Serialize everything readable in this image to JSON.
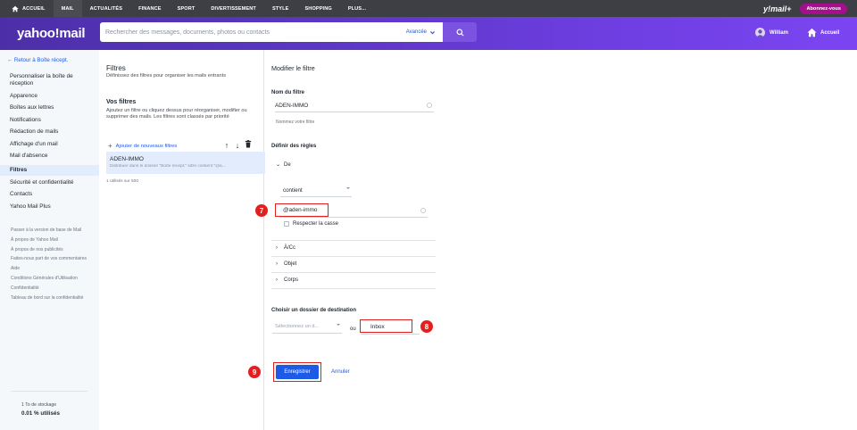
{
  "topnav": {
    "items": [
      "ACCUEIL",
      "MAIL",
      "ACTUALITÉS",
      "FINANCE",
      "SPORT",
      "DIVERTISSEMENT",
      "STYLE",
      "SHOPPING",
      "PLUS..."
    ],
    "brand": "y!mail+",
    "subscribe": "Abonnez-vous"
  },
  "header": {
    "logo": "yahoo!mail",
    "search_placeholder": "Rechercher des messages, documents, photos ou contacts",
    "advanced": "Avancée",
    "user": "William",
    "home": "Accueil"
  },
  "sidebar": {
    "back": "Retour à Boîte récept.",
    "items": [
      "Personnaliser la boîte de réception",
      "Apparence",
      "Boîtes aux lettres",
      "Notifications",
      "Rédaction de mails",
      "Affichage d'un mail",
      "Mail d'absence",
      "Filtres",
      "Sécurité et confidentialité",
      "Contacts",
      "Yahoo Mail Plus"
    ],
    "footer": [
      "Passer à la version de base de Mail",
      "À propos de Yahoo Mail",
      "À propos de nos publicités",
      "Faites-nous part de vos commentaires",
      "Aide",
      "Conditions Générales d'Utilisation",
      "Confidentialité",
      "Tableau de bord sur la confidentialité"
    ],
    "storage_total": "1 To de stockage",
    "storage_used": "0.01 % utilisés"
  },
  "filters": {
    "title": "Filtres",
    "desc": "Définissez des filtres pour organiser les mails entrants",
    "heading": "Vos filtres",
    "para": "Ajoutez un filtre ou cliquez dessus pour réorganiser, modifier ou supprimer des mails. Les filtres sont classés par priorité",
    "add": "Ajouter de nouveaux filtres",
    "item_name": "ADEN-IMMO",
    "item_desc": "Distribuer dans le dossier \"Boîte récept.\" siDe contient \"@a...",
    "count": "1 utilisés sur 500"
  },
  "edit": {
    "title": "Modifier le filtre",
    "name_label": "Nom du filtre",
    "name_value": "ADEN-IMMO",
    "name_hint": "Nommez votre filtre",
    "rules_label": "Définir des règles",
    "from": "De",
    "condition": "contient",
    "from_value": "@aden-immo",
    "match_case": "Respecter la casse",
    "to_cc": "À/Cc",
    "subject": "Objet",
    "body": "Corps",
    "dest_label": "Choisir un dossier de destination",
    "folder_placeholder": "Sélectionnez un d...",
    "or": "ou",
    "new_folder": "Inbox",
    "save": "Enregistrer",
    "cancel": "Annuler"
  },
  "annotations": [
    "7",
    "8",
    "9"
  ],
  "colors": {
    "accent": "#1d5ae6",
    "header": "#6d3ee0",
    "annotation": "#e4201f"
  }
}
